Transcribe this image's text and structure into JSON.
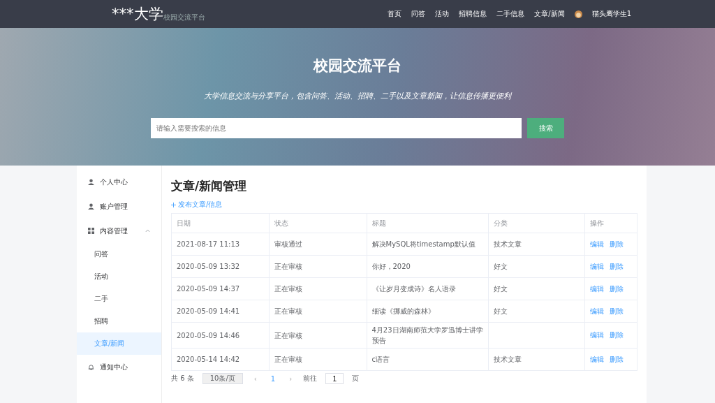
{
  "header": {
    "logo": "***大学",
    "logo_sub": "校园交流平台",
    "nav": [
      {
        "label": "首页",
        "selected": false
      },
      {
        "label": "问答",
        "selected": false
      },
      {
        "label": "活动",
        "selected": false
      },
      {
        "label": "招聘信息",
        "selected": false
      },
      {
        "label": "二手信息",
        "selected": false
      },
      {
        "label": "文章/新闻",
        "selected": false
      }
    ],
    "user": "猫头鹰学生1"
  },
  "banner": {
    "title": "校园交流平台",
    "subtitle": "大学信息交流与分享平台，包含问答、活动、招聘、二手以及文章新闻，让信息传播更便利",
    "search": {
      "placeholder": "请输入需要搜索的信息",
      "button": "搜索"
    }
  },
  "sidebar": {
    "items": [
      {
        "label": "个人中心",
        "kind": "person",
        "selected": false
      },
      {
        "label": "账户管理",
        "kind": "person",
        "selected": false
      },
      {
        "label": "内容管理",
        "kind": "grid",
        "selected": false,
        "expanded": true,
        "children": [
          {
            "label": "问答",
            "selected": false
          },
          {
            "label": "活动",
            "selected": false
          },
          {
            "label": "二手",
            "selected": false
          },
          {
            "label": "招聘",
            "selected": false
          },
          {
            "label": "文章/新闻",
            "selected": true
          }
        ]
      },
      {
        "label": "通知中心",
        "kind": "bell",
        "selected": false
      }
    ]
  },
  "main": {
    "title": "文章/新闻管理",
    "add_link": "发布文章/信息",
    "table": {
      "columns": [
        "日期",
        "状态",
        "标题",
        "分类",
        "操作"
      ],
      "rows": [
        {
          "date": "2021-08-17 11:13",
          "status": "审核通过",
          "title": "解决MySQL将timestamp默认值",
          "category": "技术文章",
          "edit": "编辑",
          "delete": "删除"
        },
        {
          "date": "2020-05-09 13:32",
          "status": "正在审核",
          "title": "你好，2020",
          "category": "好文",
          "edit": "编辑",
          "delete": "删除"
        },
        {
          "date": "2020-05-09 14:37",
          "status": "正在审核",
          "title": "《让岁月变成诗》名人语录",
          "category": "好文",
          "edit": "编辑",
          "delete": "删除"
        },
        {
          "date": "2020-05-09 14:41",
          "status": "正在审核",
          "title": "细读《挪威的森林》",
          "category": "好文",
          "edit": "编辑",
          "delete": "删除"
        },
        {
          "date": "2020-05-09 14:46",
          "status": "正在审核",
          "title": "4月23日湖南师范大学罗迅博士讲学预告",
          "category": "",
          "edit": "编辑",
          "delete": "删除"
        },
        {
          "date": "2020-05-14 14:42",
          "status": "正在审核",
          "title": "c语言",
          "category": "技术文章",
          "edit": "编辑",
          "delete": "删除"
        }
      ]
    },
    "pagination": {
      "total": "共 6 条",
      "page_size": "10条/页",
      "prev": "‹",
      "pages": [
        {
          "label": "1",
          "selected": true
        }
      ],
      "next": "›",
      "goto": "前往",
      "goto_value": "1",
      "goto_suffix": "页"
    }
  }
}
